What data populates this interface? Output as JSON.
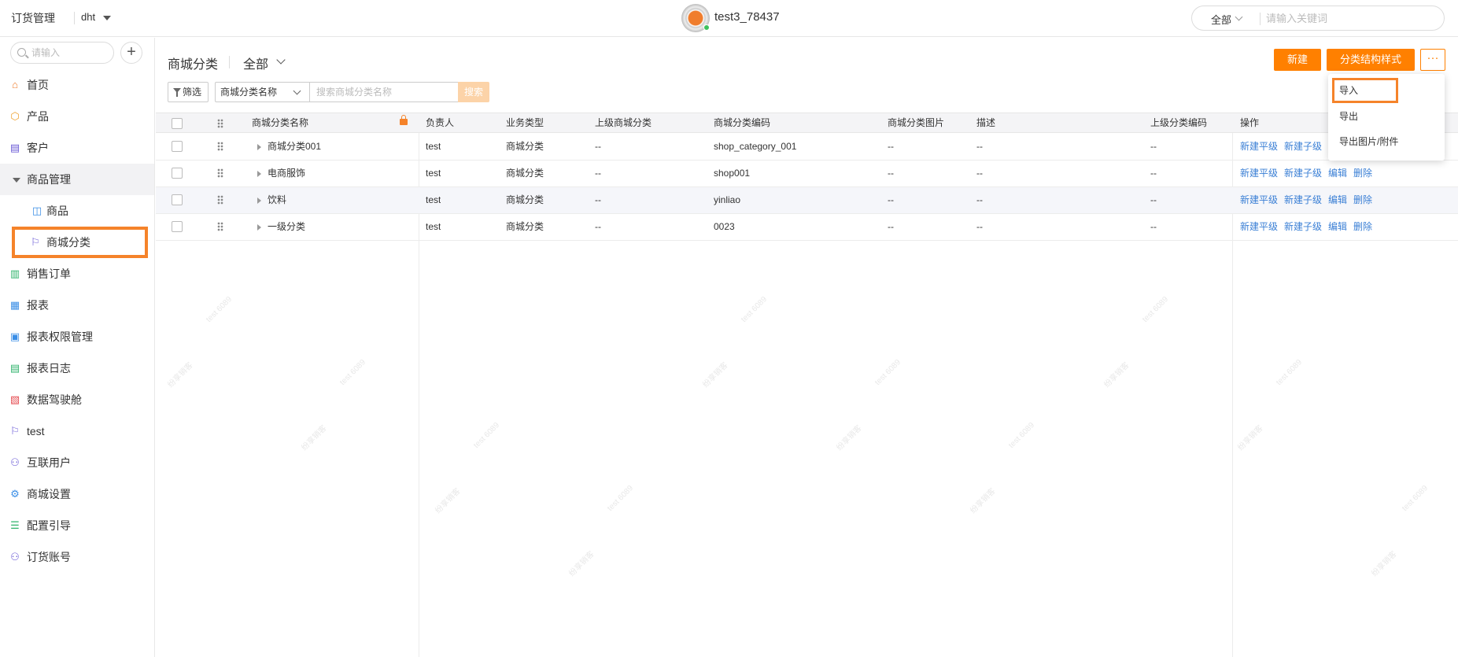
{
  "topbar": {
    "app_title": "订货管理",
    "tenant": "dht",
    "user_name": "test3_78437",
    "search_scope": "全部",
    "search_placeholder": "请输入关键词"
  },
  "sidebar": {
    "search_placeholder": "请输入",
    "add_label": "+",
    "items": [
      {
        "label": "首页",
        "icon": "home-icon"
      },
      {
        "label": "产品",
        "icon": "box-icon"
      },
      {
        "label": "客户",
        "icon": "building-icon"
      },
      {
        "label": "商品管理",
        "icon": "caret-down-icon"
      },
      {
        "label": "商品",
        "icon": "bag-icon"
      },
      {
        "label": "商城分类",
        "icon": "flag-icon"
      },
      {
        "label": "销售订单",
        "icon": "clipboard-icon"
      },
      {
        "label": "报表",
        "icon": "calendar-icon"
      },
      {
        "label": "报表权限管理",
        "icon": "report-lock-icon"
      },
      {
        "label": "报表日志",
        "icon": "log-icon"
      },
      {
        "label": "数据驾驶舱",
        "icon": "dashboard-icon"
      },
      {
        "label": "test",
        "icon": "flag-icon"
      },
      {
        "label": "互联用户",
        "icon": "users-icon"
      },
      {
        "label": "商城设置",
        "icon": "settings-icon"
      },
      {
        "label": "配置引导",
        "icon": "signpost-icon"
      },
      {
        "label": "订货账号",
        "icon": "account-icon"
      }
    ]
  },
  "main": {
    "title": "商城分类",
    "view_scope": "全部",
    "buttons": {
      "new": "新建",
      "structure": "分类结构样式",
      "more": "···"
    },
    "filter_label": "筛选",
    "field_select": "商城分类名称",
    "search_placeholder": "搜索商城分类名称",
    "search_button": "搜索"
  },
  "table": {
    "columns": [
      "商城分类名称",
      "负责人",
      "业务类型",
      "上级商城分类",
      "商城分类编码",
      "商城分类图片",
      "描述",
      "上级分类编码",
      "操作"
    ],
    "rows": [
      {
        "name": "商城分类001",
        "owner": "test",
        "type": "商城分类",
        "parent": "--",
        "code": "shop_category_001",
        "image": "--",
        "desc": "--",
        "parent_code": "--",
        "actions": [
          "新建平级",
          "新建子级"
        ]
      },
      {
        "name": "电商服饰",
        "owner": "test",
        "type": "商城分类",
        "parent": "--",
        "code": "shop001",
        "image": "--",
        "desc": "--",
        "parent_code": "--",
        "actions": [
          "新建平级",
          "新建子级",
          "编辑",
          "删除"
        ]
      },
      {
        "name": "饮料",
        "owner": "test",
        "type": "商城分类",
        "parent": "--",
        "code": "yinliao",
        "image": "--",
        "desc": "--",
        "parent_code": "--",
        "actions": [
          "新建平级",
          "新建子级",
          "编辑",
          "删除"
        ]
      },
      {
        "name": "一级分类",
        "owner": "test",
        "type": "商城分类",
        "parent": "--",
        "code": "0023",
        "image": "--",
        "desc": "--",
        "parent_code": "--",
        "actions": [
          "新建平级",
          "新建子级",
          "编辑",
          "删除"
        ]
      }
    ]
  },
  "dropdown": {
    "items": [
      "导入",
      "导出",
      "导出图片/附件"
    ]
  },
  "watermark": {
    "text1": "test 6089",
    "text2": "纷享销客"
  },
  "colors": {
    "accent": "#ff8000",
    "link": "#3a7fd5",
    "highlight_outline": "#f5832a"
  }
}
